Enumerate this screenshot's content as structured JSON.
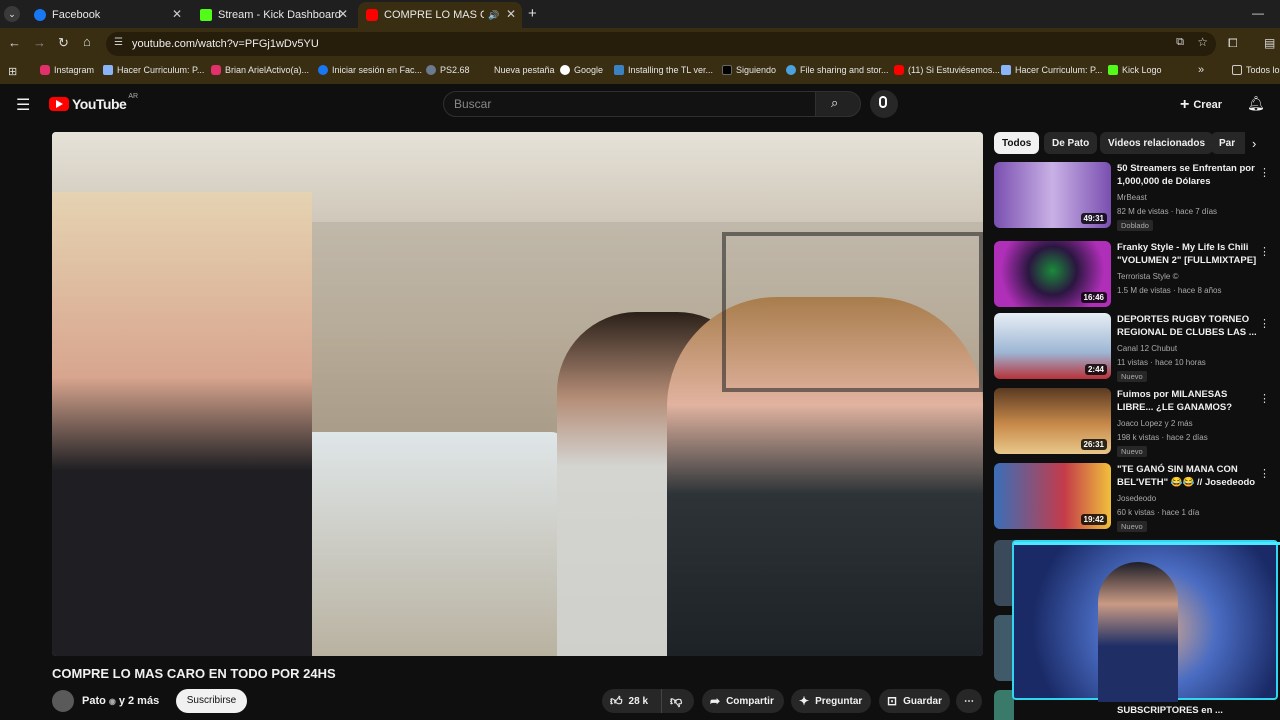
{
  "tabs": [
    {
      "title": "Facebook",
      "color": "#1877f2"
    },
    {
      "title": "Stream - Kick Dashboard",
      "color": "#53fc18"
    },
    {
      "title": "COMPRE LO MAS CARO EN",
      "color": "#ff0000"
    }
  ],
  "address": {
    "url": "youtube.com/watch?v=PFGj1wDv5YU"
  },
  "bookmarks": [
    {
      "label": "Instagram"
    },
    {
      "label": "Hacer Curriculum: P..."
    },
    {
      "label": "Brian ArielActivo(a)..."
    },
    {
      "label": "Iniciar sesión en Fac..."
    },
    {
      "label": "PS2.68"
    },
    {
      "label": "Nueva pestaña"
    },
    {
      "label": "Google"
    },
    {
      "label": "Installing the TL ver..."
    },
    {
      "label": "Siguiendo"
    },
    {
      "label": "File sharing and stor..."
    },
    {
      "label": "(11) Si Estuviésemos..."
    },
    {
      "label": "Hacer Curriculum: P..."
    },
    {
      "label": "Kick Logo"
    },
    {
      "label": "Todos los"
    }
  ],
  "yt": {
    "logo": "YouTube",
    "country": "AR",
    "search_placeholder": "Buscar",
    "create_label": "Crear"
  },
  "video": {
    "title": "COMPRE LO MAS CARO EN TODO POR 24HS",
    "channel": "Pato",
    "subs": "y 2 más",
    "subscribe_label": "Suscribirse",
    "likes": "28 k",
    "share_label": "Compartir",
    "ask_label": "Preguntar",
    "save_label": "Guardar"
  },
  "chips": [
    "Todos",
    "De Pato",
    "Videos relacionados",
    "Par"
  ],
  "recommendations": [
    {
      "title": "50 Streamers se Enfrentan por 1,000,000 de Dólares",
      "channel": "MrBeast",
      "meta": "82 M de vistas · hace 7 días",
      "badge": "Doblado",
      "duration": "49:31"
    },
    {
      "title": "Franky Style - My Life Is Chili \"VOLUMEN 2\" [FULLMIXTAPE]",
      "channel": "Terrorista Style ©",
      "meta": "1.5 M de vistas · hace 8 años",
      "badge": "",
      "duration": "16:46"
    },
    {
      "title": "DEPORTES RUGBY TORNEO REGIONAL DE CLUBES   LAS ...",
      "channel": "Canal 12 Chubut",
      "meta": "11 vistas · hace 10 horas",
      "badge": "Nuevo",
      "duration": "2:44"
    },
    {
      "title": "Fuimos por MILANESAS LIBRE... ¿LE GANAMOS?",
      "channel": "Joaco Lopez  y 2 más",
      "meta": "198 k vistas · hace 2 días",
      "badge": "Nuevo",
      "duration": "26:31"
    },
    {
      "title": "\"TE GANÓ SIN MANA CON BEL'VETH\" 😂😂 // Josedeodo",
      "channel": "Josedeodo",
      "meta": "60 k vistas · hace 1 día",
      "badge": "Nuevo",
      "duration": "19:42"
    }
  ],
  "bottom_rec_title": "SUBSCRIPTORES en ..."
}
